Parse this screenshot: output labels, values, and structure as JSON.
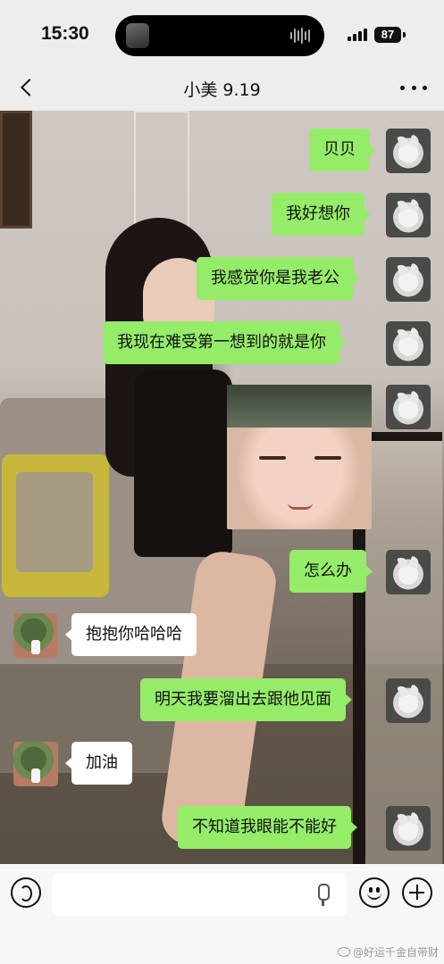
{
  "status_bar": {
    "time": "15:30",
    "battery": "87",
    "signal_icon": "signal-bars-icon",
    "island_icons": [
      "music-thumbnail-icon",
      "audio-wave-icon"
    ]
  },
  "nav": {
    "back_icon": "chevron-left-icon",
    "title": "小美 9.19",
    "more_icon": "more-dots-icon"
  },
  "messages": [
    {
      "side": "right",
      "type": "text",
      "text": "贝贝",
      "avatar": "cat-avatar"
    },
    {
      "side": "right",
      "type": "text",
      "text": "我好想你",
      "avatar": "cat-avatar"
    },
    {
      "side": "right",
      "type": "text",
      "text": "我感觉你是我老公",
      "avatar": "cat-avatar"
    },
    {
      "side": "right",
      "type": "text",
      "text": "我现在难受第一想到的就是你",
      "avatar": "cat-avatar"
    },
    {
      "side": "right",
      "type": "sticker",
      "sticker": "sleepy-child-face-sticker",
      "avatar": "cat-avatar"
    },
    {
      "side": "right",
      "type": "text",
      "text": "怎么办",
      "avatar": "cat-avatar"
    },
    {
      "side": "left",
      "type": "text",
      "text": "抱抱你哈哈哈",
      "avatar": "tree-avatar"
    },
    {
      "side": "right",
      "type": "text",
      "text": "明天我要溜出去跟他见面",
      "avatar": "cat-avatar"
    },
    {
      "side": "left",
      "type": "text",
      "text": "加油",
      "avatar": "tree-avatar"
    },
    {
      "side": "right",
      "type": "text",
      "text": "不知道我眼能不能好",
      "avatar": "cat-avatar"
    }
  ],
  "input_bar": {
    "voice_icon": "voice-icon",
    "input_value": "",
    "mic_icon": "mic-icon",
    "emoji_icon": "emoji-icon",
    "add_icon": "plus-icon"
  },
  "watermark": {
    "text": "@好运千金自带财",
    "icon": "weibo-icon"
  },
  "colors": {
    "sent_bubble": "#95ec69",
    "received_bubble": "#ffffff",
    "bar_background": "#ededed"
  }
}
